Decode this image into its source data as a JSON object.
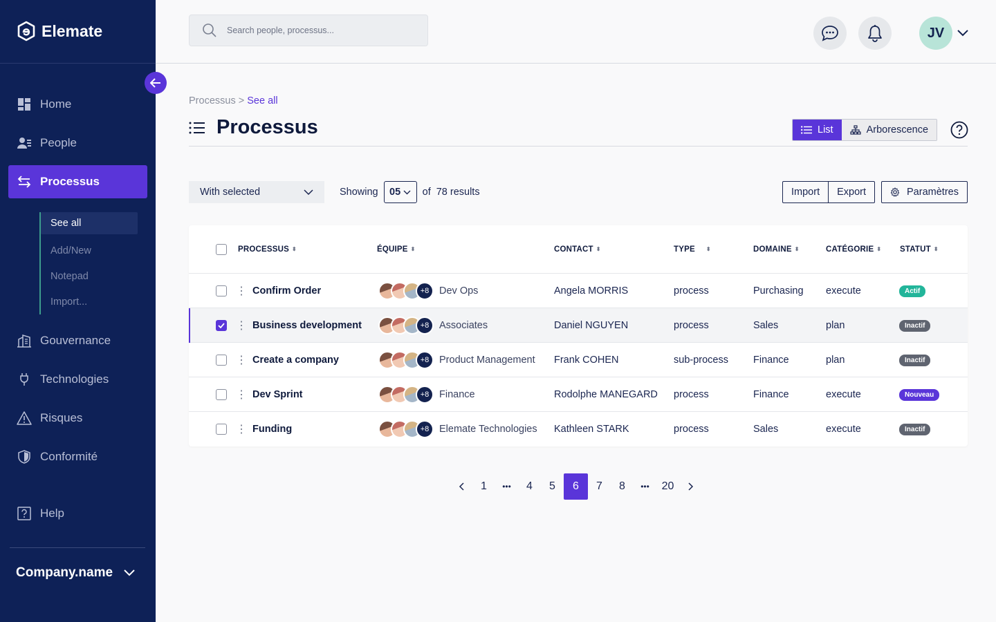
{
  "brand": {
    "name": "Elemate"
  },
  "sidebar": {
    "nav": [
      {
        "label": "Home",
        "icon": "dashboard-icon"
      },
      {
        "label": "People",
        "icon": "people-icon"
      },
      {
        "label": "Processus",
        "icon": "arrows-icon",
        "active": true
      },
      {
        "label": "Gouvernance",
        "icon": "building-icon"
      },
      {
        "label": "Technologies",
        "icon": "plug-icon"
      },
      {
        "label": "Risques",
        "icon": "warning-icon"
      },
      {
        "label": "Conformité",
        "icon": "shield-icon"
      },
      {
        "label": "Help",
        "icon": "help-icon"
      }
    ],
    "subnav": [
      {
        "label": "See all",
        "active": true
      },
      {
        "label": "Add/New"
      },
      {
        "label": "Notepad"
      },
      {
        "label": "Import..."
      }
    ],
    "company": "Company.name"
  },
  "topbar": {
    "search_placeholder": "Search people, processus...",
    "user_initials": "JV"
  },
  "breadcrumb": {
    "parent": "Processus",
    "separator": ">",
    "current": "See all"
  },
  "page": {
    "title": "Processus"
  },
  "view_toggle": {
    "list": "List",
    "tree": "Arborescence"
  },
  "toolbar": {
    "with_selected": "With selected",
    "showing_label": "Showing",
    "per_page": "05",
    "of_label": "of",
    "results": "78 results",
    "import": "Import",
    "export": "Export",
    "settings": "Paramètres"
  },
  "table": {
    "columns": [
      "PROCESSUS",
      "ÉQUIPE",
      "CONTACT",
      "TYPE",
      "DOMAINE",
      "CATÉGORIE",
      "STATUT"
    ],
    "rows": [
      {
        "processus": "Confirm Order",
        "team_more": "+8",
        "team": "Dev Ops",
        "contact": "Angela MORRIS",
        "type": "process",
        "domaine": "Purchasing",
        "categorie": "execute",
        "statut": "Actif",
        "statut_color": "#22b59a",
        "checked": false
      },
      {
        "processus": "Business development",
        "team_more": "+8",
        "team": "Associates",
        "contact": "Daniel NGUYEN",
        "type": "process",
        "domaine": "Sales",
        "categorie": "plan",
        "statut": "Inactif",
        "statut_color": "#5f6470",
        "checked": true
      },
      {
        "processus": "Create a company",
        "team_more": "+8",
        "team": "Product Management",
        "contact": "Frank COHEN",
        "type": "sub-process",
        "domaine": "Finance",
        "categorie": "plan",
        "statut": "Inactif",
        "statut_color": "#5f6470",
        "checked": false
      },
      {
        "processus": "Dev Sprint",
        "team_more": "+8",
        "team": "Finance",
        "contact": "Rodolphe MANEGARD",
        "type": "process",
        "domaine": "Finance",
        "categorie": "execute",
        "statut": "Nouveau",
        "statut_color": "#5a35d9",
        "checked": false
      },
      {
        "processus": "Funding",
        "team_more": "+8",
        "team": "Elemate Technologies",
        "contact": "Kathleen STARK",
        "type": "process",
        "domaine": "Sales",
        "categorie": "execute",
        "statut": "Inactif",
        "statut_color": "#5f6470",
        "checked": false
      }
    ]
  },
  "pagination": {
    "pages": [
      "1",
      "•••",
      "4",
      "5",
      "6",
      "7",
      "8",
      "•••",
      "20"
    ],
    "current": "6"
  },
  "colors": {
    "sidebar": "#0e2157",
    "accent": "#5a35d9",
    "avatar_bg": "#b8e4d8"
  }
}
